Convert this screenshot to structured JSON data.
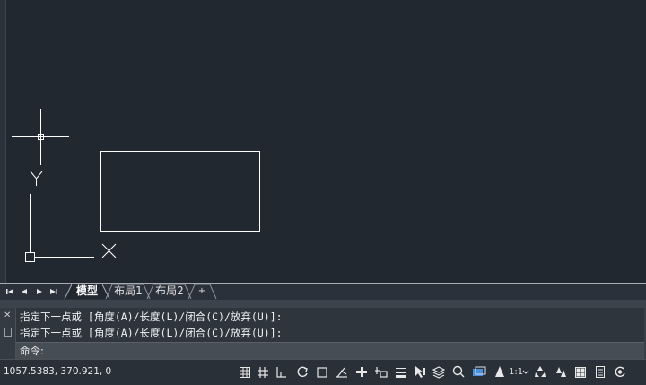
{
  "axes": {
    "x_label": "X",
    "y_label": "Y"
  },
  "layout_tabs": {
    "nav": [
      "⏮",
      "◀",
      "▶",
      "⏭"
    ],
    "tabs": [
      {
        "label": "模型",
        "active": true
      },
      {
        "label": "布局1",
        "active": false
      },
      {
        "label": "布局2",
        "active": false
      }
    ],
    "add_label": "+"
  },
  "command_line": {
    "close_glyph": "✕",
    "history": [
      "指定下一点或 [角度(A)/长度(L)/闭合(C)/放弃(U)]:",
      "指定下一点或 [角度(A)/长度(L)/闭合(C)/放弃(U)]:"
    ],
    "prompt": "命令:",
    "input_value": ""
  },
  "status_bar": {
    "coordinates": "1057.5383, 370.921, 0",
    "annotation_scale": "1:1",
    "icons": [
      "grid-icon",
      "snap-icon",
      "ortho-icon",
      "polar-icon",
      "osnap-icon",
      "otrack-icon",
      "dynamic-ucs-icon",
      "dynamic-input-icon",
      "lineweight-icon",
      "transparency-icon",
      "selection-cycling-icon",
      "layers-icon",
      "zoom-icon",
      "workspace-icon",
      "annotation-scale-icon",
      "annotation-visibility-icon",
      "auto-scale-icon",
      "hardware-accel-icon",
      "quick-properties-icon",
      "customize-icon"
    ]
  },
  "colors": {
    "canvas": "#212830",
    "drawing_lines": "#ffffff",
    "cmd_bg": "#3a4048"
  }
}
